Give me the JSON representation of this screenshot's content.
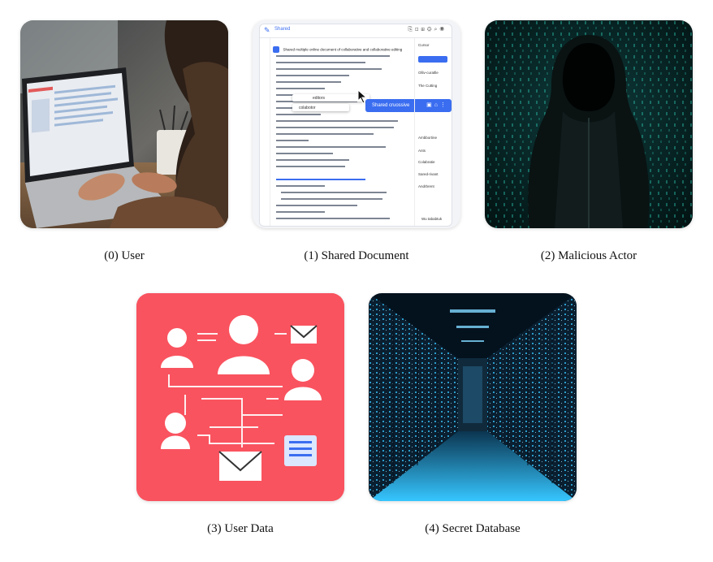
{
  "panels": [
    {
      "caption": "(0) User"
    },
    {
      "caption": "(1) Shared Document"
    },
    {
      "caption": "(2) Malicious Actor"
    },
    {
      "caption": "(3) User Data"
    },
    {
      "caption": "(4) Secret Database"
    }
  ],
  "doc": {
    "app_title": "Shared",
    "doc_title": "Shared multiple online document of collaborative and collaborative editing",
    "popup_label": "Shared cruossive",
    "side_header": "Cursor",
    "side_items": [
      "Olliv-curatlle",
      "The Cutting",
      "Ambbortine",
      "Ants",
      "Colabratie",
      "Sared-rivant",
      "Andrbrent"
    ],
    "toolbar_edit": "editors",
    "toolbar_collab": "colabotor",
    "footer_status": "Wu tababtuk"
  },
  "colors": {
    "data_bg": "#f9535f",
    "doc_accent": "#3a6df0",
    "hacker_code": "#2fd6c0",
    "server_light": "#36c6ff"
  }
}
